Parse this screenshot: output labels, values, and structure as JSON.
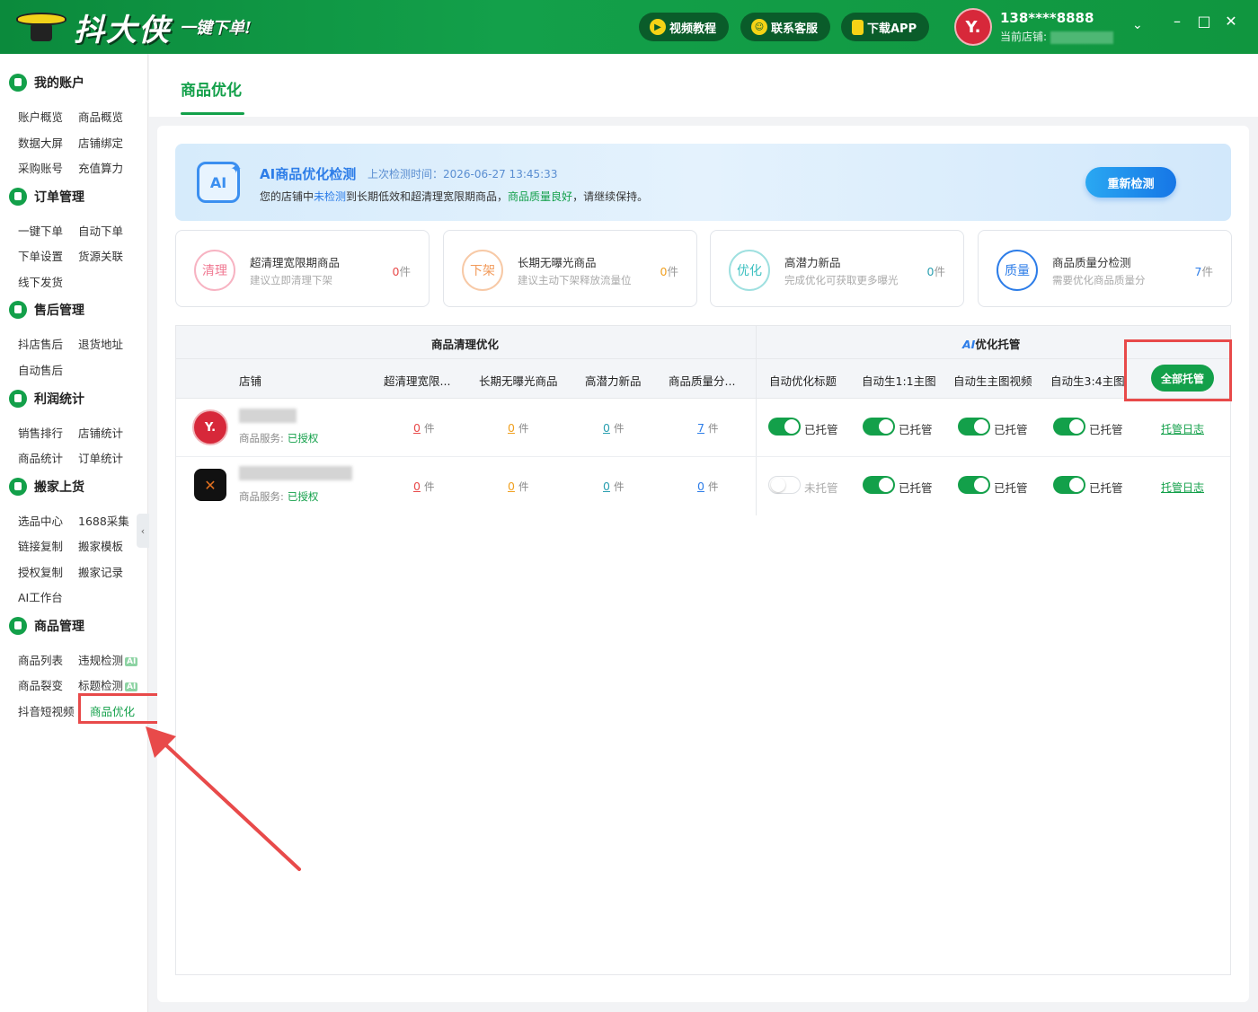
{
  "titlebar": {
    "logo_text": "抖大侠",
    "logo_slogan": "一键下单!",
    "buttons": [
      {
        "label": "视频教程",
        "icon": "play-icon"
      },
      {
        "label": "联系客服",
        "icon": "chat-icon"
      },
      {
        "label": "下载APP",
        "icon": "phone-icon"
      }
    ],
    "avatar_text": "Y.",
    "phone": "138****8888",
    "current_shop_label": "当前店铺:",
    "window_controls": [
      "minimize-icon",
      "maximize-icon",
      "close-icon"
    ]
  },
  "sidebar": {
    "sections": [
      {
        "title": "我的账户",
        "icon": "user-icon",
        "items": [
          "账户概览",
          "商品概览",
          "数据大屏",
          "店铺绑定",
          "采购账号",
          "充值算力"
        ]
      },
      {
        "title": "订单管理",
        "icon": "order-icon",
        "items": [
          "一键下单",
          "自动下单",
          "下单设置",
          "货源关联",
          "线下发货"
        ]
      },
      {
        "title": "售后管理",
        "icon": "tag-icon",
        "items": [
          "抖店售后",
          "退货地址",
          "自动售后"
        ]
      },
      {
        "title": "利润统计",
        "icon": "bar-chart-icon",
        "items": [
          "销售排行",
          "店铺统计",
          "商品统计",
          "订单统计"
        ]
      },
      {
        "title": "搬家上货",
        "icon": "upload-icon",
        "items": [
          "选品中心",
          "1688采集",
          "链接复制",
          "搬家模板",
          "授权复制",
          "搬家记录",
          "AI工作台"
        ]
      },
      {
        "title": "商品管理",
        "icon": "box-icon",
        "items": [
          "商品列表",
          "违规检测",
          "商品裂变",
          "标题检测",
          "抖音短视频",
          "商品优化"
        ]
      }
    ],
    "ai_badge": "AI",
    "active_item": "商品优化"
  },
  "page": {
    "tab_label": "商品优化"
  },
  "ai_banner": {
    "logo_text": "AI",
    "title": "AI商品优化检测",
    "last_check_label": "上次检测时间：2026-06-27 13:45:33",
    "desc_prefix": "您的店铺中",
    "desc_highlight": "未检测",
    "desc_middle": "到长期低效和超清理宽限期商品，",
    "desc_good": "商品质量良好",
    "desc_suffix": "，请继续保持。",
    "recheck_button": "重新检测"
  },
  "stat_cards": [
    {
      "badge": "清理",
      "title": "超清理宽限期商品",
      "sub": "建议立即清理下架",
      "count": "0",
      "unit": "件",
      "color": "#f07a93"
    },
    {
      "badge": "下架",
      "title": "长期无曝光商品",
      "sub": "建议主动下架释放流量位",
      "count": "0",
      "unit": "件",
      "color": "#f29a5a"
    },
    {
      "badge": "优化",
      "title": "高潜力新品",
      "sub": "完成优化可获取更多曝光",
      "count": "0",
      "unit": "件",
      "color": "#3cc0c0"
    },
    {
      "badge": "质量",
      "title": "商品质量分检测",
      "sub": "需要优化商品质量分",
      "count": "7",
      "unit": "件",
      "color": "#2d7de8"
    }
  ],
  "table": {
    "group_clean": "商品清理优化",
    "group_ai_prefix": "AI",
    "group_ai_suffix": "优化托管",
    "columns": [
      "店铺",
      "超清理宽限...",
      "长期无曝光商品",
      "高潜力新品",
      "商品质量分...",
      "自动优化标题",
      "自动生1:1主图",
      "自动生主图视频",
      "自动生3:4主图"
    ],
    "all_button": "全部托管",
    "service_label": "商品服务:",
    "authorized_label": "已授权",
    "unit": "件",
    "on_label": "已托管",
    "off_label": "未托管",
    "log_link": "托管日志",
    "rows": [
      {
        "avatar_text": "Y.",
        "counts": [
          "0",
          "0",
          "0",
          "7"
        ],
        "toggles": [
          true,
          true,
          true,
          true
        ]
      },
      {
        "avatar_text": "",
        "counts": [
          "0",
          "0",
          "0",
          "0"
        ],
        "toggles": [
          false,
          true,
          true,
          true
        ]
      }
    ]
  },
  "colors": {
    "brand_green": "#13a04a",
    "accent_blue": "#2d7de8",
    "count_red": "#e84a4a",
    "count_orange": "#f0a020",
    "count_teal": "#2a9fb0",
    "count_blue": "#2d7de8",
    "highlight_red": "#e84a4a"
  }
}
